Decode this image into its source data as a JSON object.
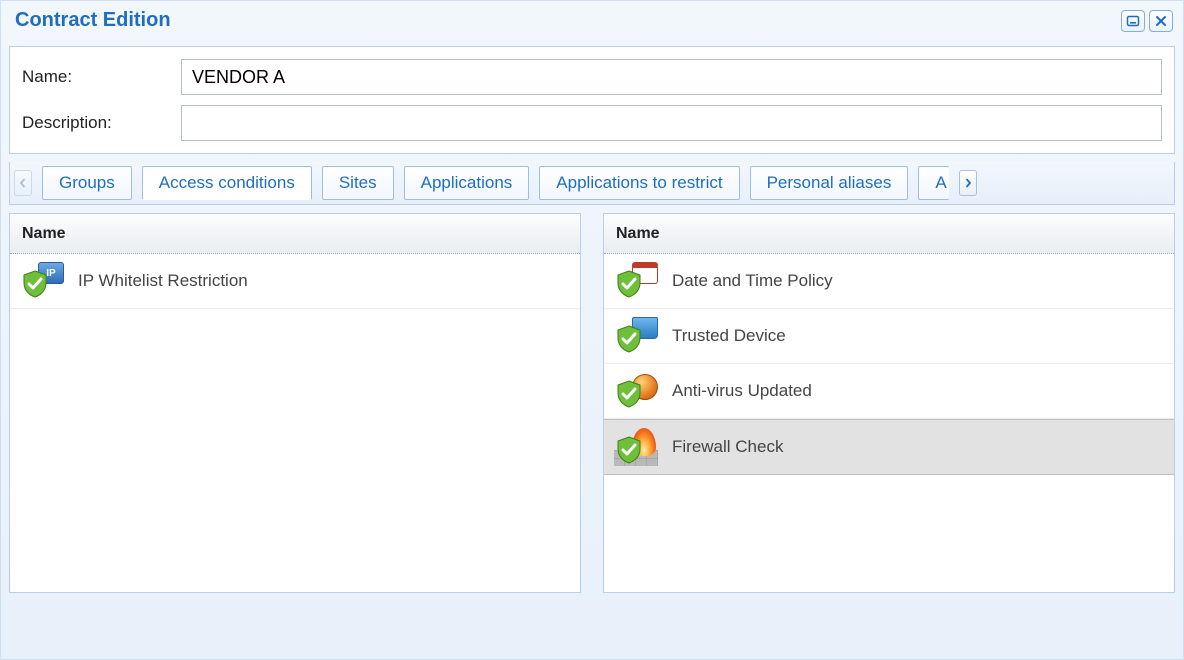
{
  "window": {
    "title": "Contract Edition"
  },
  "form": {
    "name_label": "Name:",
    "name_value": "VENDOR A",
    "description_label": "Description:",
    "description_value": ""
  },
  "tabs": {
    "items": [
      {
        "label": "Groups"
      },
      {
        "label": "Access conditions"
      },
      {
        "label": "Sites"
      },
      {
        "label": "Applications"
      },
      {
        "label": "Applications to restrict"
      },
      {
        "label": "Personal aliases"
      }
    ],
    "overflow_label": "A",
    "active_index": 1
  },
  "panes": {
    "left": {
      "header": "Name",
      "items": [
        {
          "label": "IP Whitelist Restriction",
          "icon": "ip",
          "selected": false
        }
      ]
    },
    "right": {
      "header": "Name",
      "items": [
        {
          "label": "Date and Time Policy",
          "icon": "calendar",
          "selected": false
        },
        {
          "label": "Trusted Device",
          "icon": "folder",
          "selected": false
        },
        {
          "label": "Anti-virus Updated",
          "icon": "antivirus",
          "selected": false
        },
        {
          "label": "Firewall Check",
          "icon": "firewall",
          "selected": true
        }
      ]
    }
  }
}
